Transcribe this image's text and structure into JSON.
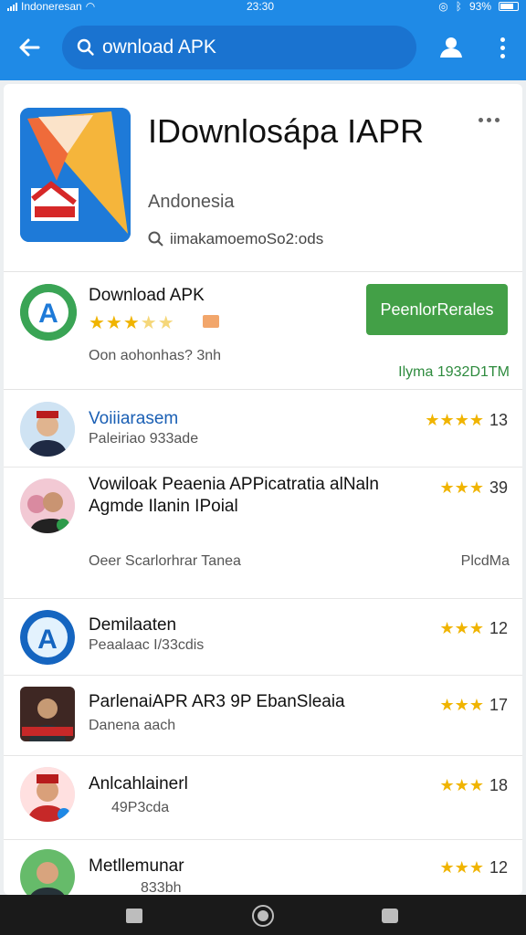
{
  "status_bar": {
    "carrier": "Indoneresan",
    "time": "23:30",
    "battery": "93%"
  },
  "toolbar": {
    "search_value": "ownload APK"
  },
  "hero": {
    "title": "IDownlosápa IAPR",
    "subtitle": "Andonesia",
    "developer": "iimakamoemoSo2:ods"
  },
  "featured": {
    "name": "Download APK",
    "meta": "Oon aohonhas? 3nh",
    "install_label": "PeenlorRerales",
    "count": "Ilyma 1932D1TM"
  },
  "items": [
    {
      "title": "Voiiiarasem",
      "sub": "Paleiriao 933ade",
      "rating": "13"
    },
    {
      "title": "Vowiloak Peaenia APPicatratia alNaln",
      "title2": "Agmde Ilanin IPoial",
      "sub": "Oeer Scarlorhrar Tanea",
      "rating": "39",
      "extra": "PlcdMa"
    },
    {
      "title": "Demilaaten",
      "sub": "Peaalaac I/33cdis",
      "rating": "12"
    },
    {
      "title": "ParlenaiAPR AR3 9P EbanSleaia",
      "sub": "Danena aach",
      "rating": "17"
    },
    {
      "title": "Anlcahlainerl",
      "sub": "49P3cda",
      "rating": "18"
    },
    {
      "title": "Metllemunar",
      "sub": "833bh",
      "rating": "12"
    }
  ],
  "colors": {
    "primary": "#1f8ae6",
    "install": "#43a047",
    "star": "#f0b400"
  }
}
